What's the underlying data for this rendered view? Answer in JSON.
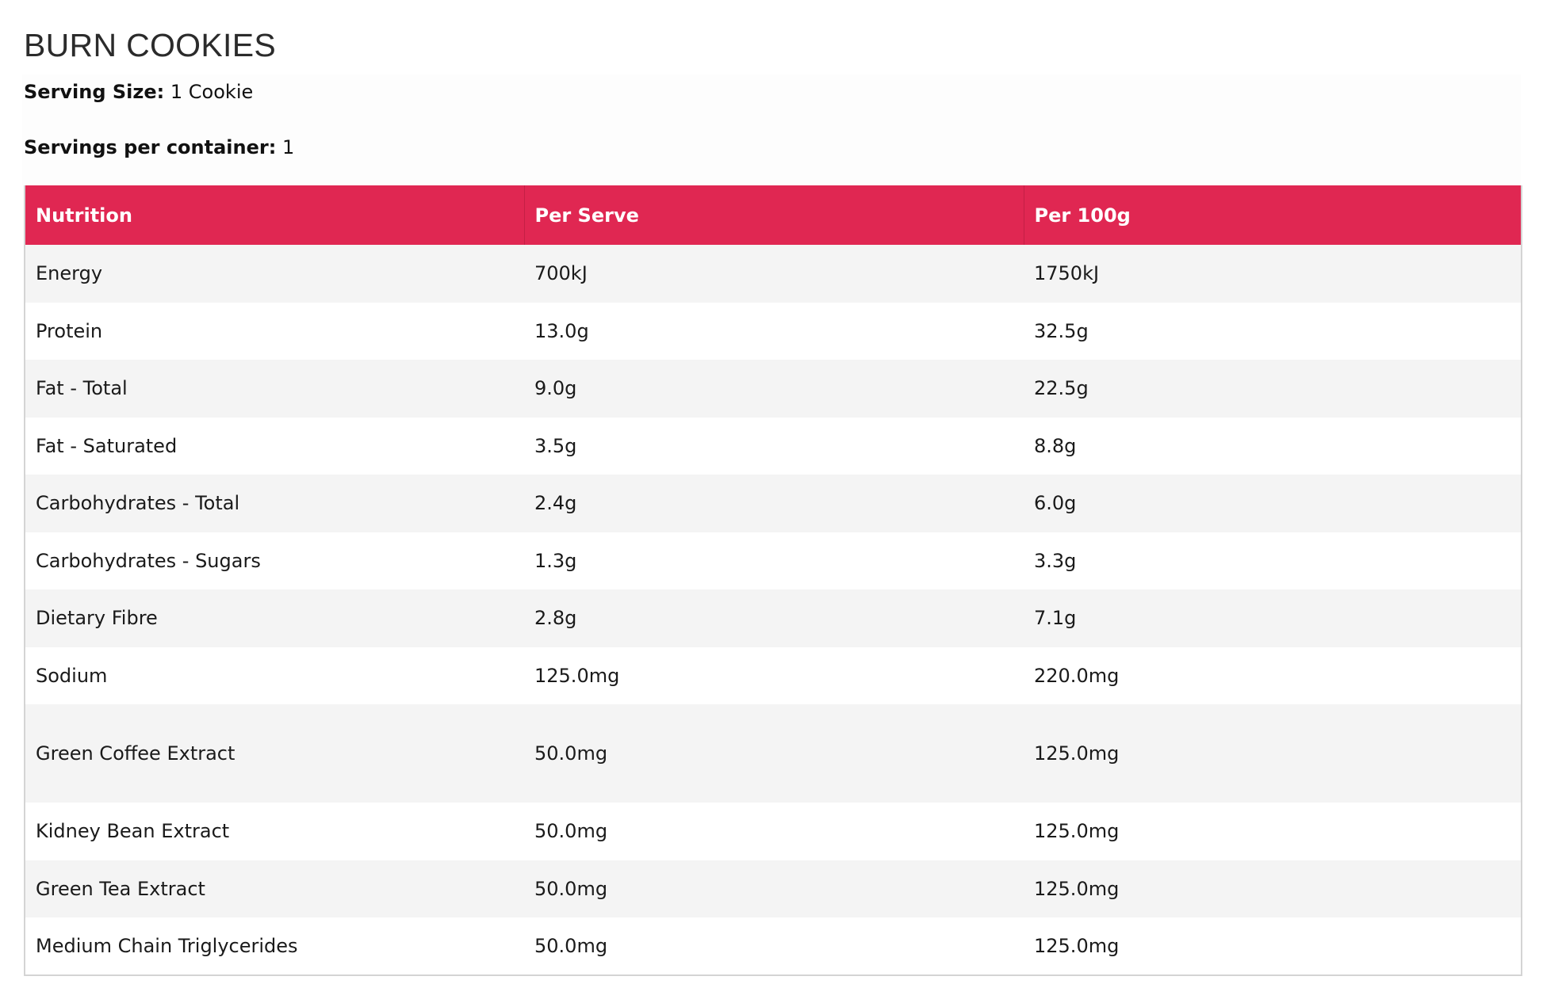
{
  "title": "BURN COOKIES",
  "serving_size": {
    "label": "Serving Size:",
    "value": "1 Cookie"
  },
  "servings_per_container": {
    "label": "Servings per container:",
    "value": "1"
  },
  "table": {
    "headers": [
      "Nutrition",
      "Per Serve",
      "Per 100g"
    ],
    "header_color": "#e02752",
    "rows": [
      [
        "Energy",
        "700kJ",
        "1750kJ"
      ],
      [
        "Protein",
        "13.0g",
        "32.5g"
      ],
      [
        "Fat - Total",
        "9.0g",
        "22.5g"
      ],
      [
        "Fat - Saturated",
        "3.5g",
        "8.8g"
      ],
      [
        "Carbohydrates - Total",
        "2.4g",
        "6.0g"
      ],
      [
        "Carbohydrates - Sugars",
        "1.3g",
        "3.3g"
      ],
      [
        "Dietary Fibre",
        "2.8g",
        "7.1g"
      ],
      [
        "Sodium",
        "125.0mg",
        "220.0mg"
      ],
      [
        "Green Coffee Extract",
        "50.0mg",
        "125.0mg"
      ],
      [
        "Kidney Bean Extract",
        "50.0mg",
        "125.0mg"
      ],
      [
        "Green Tea Extract",
        "50.0mg",
        "125.0mg"
      ],
      [
        "Medium Chain Triglycerides",
        "50.0mg",
        "125.0mg"
      ]
    ]
  }
}
